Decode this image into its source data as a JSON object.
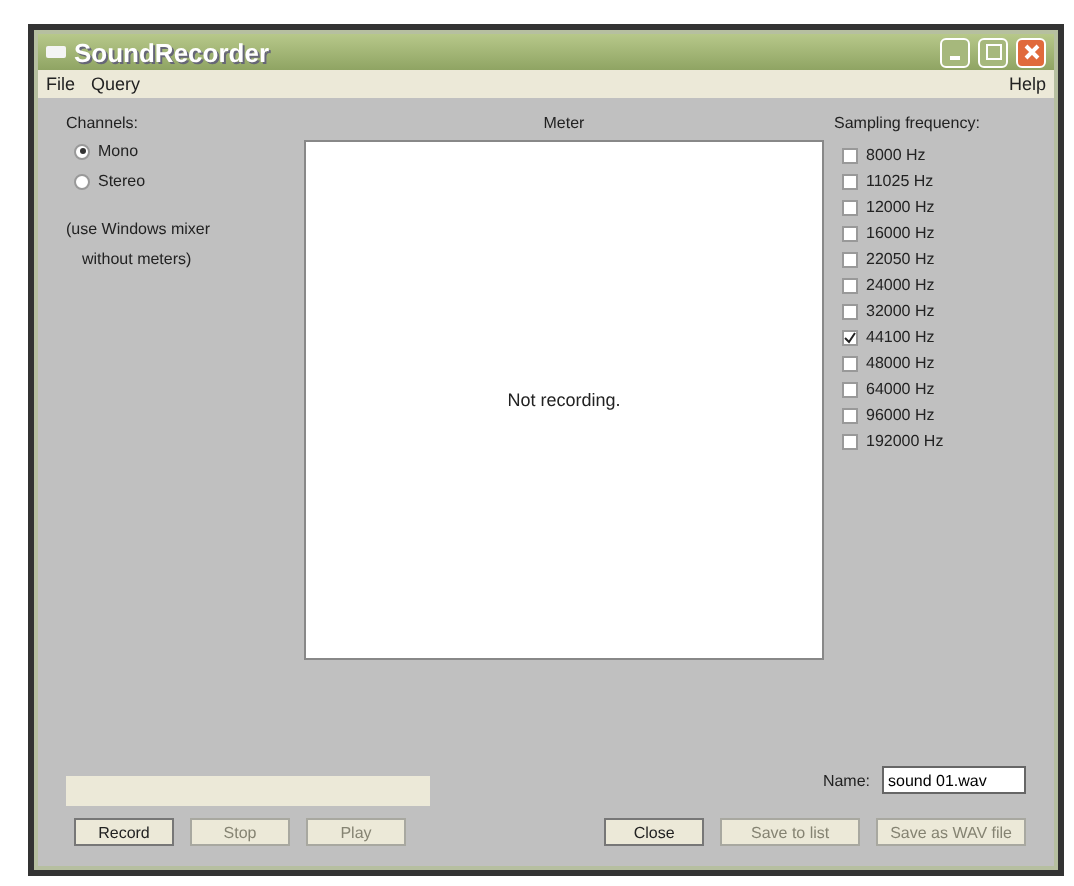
{
  "window": {
    "title": "SoundRecorder"
  },
  "menu": {
    "left": [
      "File",
      "Query"
    ],
    "right": [
      "Help"
    ]
  },
  "channels": {
    "label": "Channels:",
    "options": [
      {
        "label": "Mono",
        "selected": true
      },
      {
        "label": "Stereo",
        "selected": false
      }
    ],
    "notes": [
      "(use Windows mixer",
      "without meters)"
    ]
  },
  "meter": {
    "label": "Meter",
    "status": "Not recording."
  },
  "sampling": {
    "label": "Sampling frequency:",
    "options": [
      {
        "label": "8000 Hz",
        "checked": false
      },
      {
        "label": "11025 Hz",
        "checked": false
      },
      {
        "label": "12000 Hz",
        "checked": false
      },
      {
        "label": "16000 Hz",
        "checked": false
      },
      {
        "label": "22050 Hz",
        "checked": false
      },
      {
        "label": "24000 Hz",
        "checked": false
      },
      {
        "label": "32000 Hz",
        "checked": false
      },
      {
        "label": "44100 Hz",
        "checked": true
      },
      {
        "label": "48000 Hz",
        "checked": false
      },
      {
        "label": "64000 Hz",
        "checked": false
      },
      {
        "label": "96000 Hz",
        "checked": false
      },
      {
        "label": "192000 Hz",
        "checked": false
      }
    ]
  },
  "transport": [
    {
      "label": "Record",
      "disabled": false
    },
    {
      "label": "Stop",
      "disabled": true
    },
    {
      "label": "Play",
      "disabled": true
    }
  ],
  "name": {
    "label": "Name:",
    "value": "sound 01.wav"
  },
  "actions": [
    {
      "label": "Close",
      "disabled": false
    },
    {
      "label": "Save to list",
      "disabled": true
    },
    {
      "label": "Save as WAV file",
      "disabled": true
    }
  ]
}
